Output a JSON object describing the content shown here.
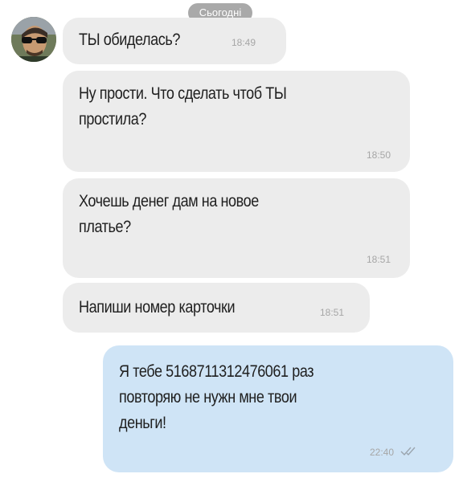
{
  "chat": {
    "date_label": "Сьогодні",
    "messages": [
      {
        "direction": "incoming",
        "lines": [
          "ТЫ обиделась?"
        ],
        "time": "18:49"
      },
      {
        "direction": "incoming",
        "lines": [
          "Ну прости. Что сделать чтоб ТЫ",
          "простила?"
        ],
        "time": "18:50"
      },
      {
        "direction": "incoming",
        "lines": [
          "Хочешь денег дам на новое",
          "платье?"
        ],
        "time": "18:51"
      },
      {
        "direction": "incoming",
        "lines": [
          "Напиши номер карточки"
        ],
        "time": "18:51"
      },
      {
        "direction": "outgoing",
        "lines": [
          "Я тебе 5168711312476061 раз",
          "повторяю не нужн мне твои",
          "деньги!"
        ],
        "time": "22:40",
        "status_icon": "double-check-icon"
      }
    ]
  },
  "colors": {
    "incoming_bubble": "#ececec",
    "outgoing_bubble": "#cfe4f6",
    "date_pill": "#a9a9a9",
    "time_text": "#a6a6a6"
  }
}
